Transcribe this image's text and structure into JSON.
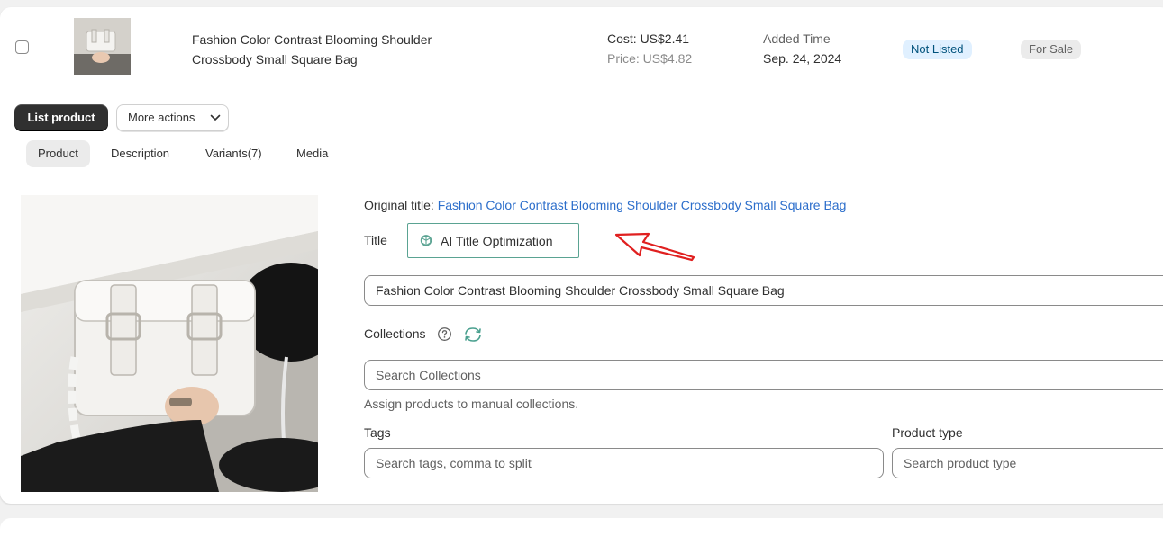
{
  "product_row": {
    "name": "Fashion Color Contrast Blooming Shoulder Crossbody Small Square Bag",
    "cost": "Cost: US$2.41",
    "price": "Price: US$4.82",
    "added_label": "Added Time",
    "added_date": "Sep. 24, 2024",
    "status_listed": "Not Listed",
    "status_sale": "For Sale"
  },
  "actions": {
    "list_product": "List product",
    "more_actions": "More actions"
  },
  "tabs": [
    {
      "label": "Product",
      "active": true
    },
    {
      "label": "Description",
      "active": false
    },
    {
      "label": "Variants(7)",
      "active": false
    },
    {
      "label": "Media",
      "active": false
    }
  ],
  "form": {
    "original_title_prefix": "Original title: ",
    "original_title_link": "Fashion Color Contrast Blooming Shoulder Crossbody Small Square Bag",
    "title_label": "Title",
    "ai_button": "AI Title Optimization",
    "title_value": "Fashion Color Contrast Blooming Shoulder Crossbody Small Square Bag",
    "collections_label": "Collections",
    "collections_placeholder": "Search Collections",
    "collections_help": "Assign products to manual collections.",
    "tags_label": "Tags",
    "tags_placeholder": "Search tags, comma to split",
    "product_type_label": "Product type",
    "product_type_placeholder": "Search product type"
  },
  "icons": {
    "checkbox": "checkbox-icon",
    "chevron": "chevron-down-icon",
    "ai": "openai-icon",
    "help": "question-circle-icon",
    "sync": "refresh-icon",
    "annotation": "red-arrow-annotation"
  },
  "colors": {
    "primary_button": "#303030",
    "link": "#2c6ecb",
    "ai_border": "#5aa392",
    "badge_info_bg": "#e0f0ff",
    "badge_neutral_bg": "#ebebeb",
    "arrow": "#e02020"
  }
}
